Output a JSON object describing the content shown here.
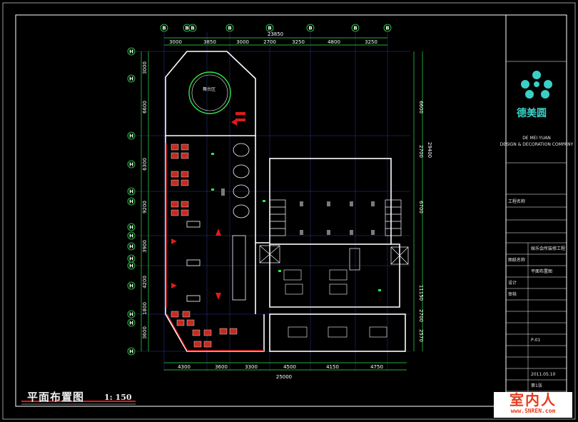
{
  "drawing": {
    "title": "平面布置图",
    "scale": "1: 150"
  },
  "dimensions": {
    "top_total": "23850",
    "top_segments": [
      "3000",
      "3850",
      "3000",
      "2700",
      "3250",
      "4800",
      "3250"
    ],
    "bottom_total": "25000",
    "bottom_segments": [
      "4300",
      "3600",
      "3300",
      "4500",
      "4150",
      "4750"
    ],
    "left_segments": [
      "3000",
      "6600",
      "6300",
      "9200",
      "3900",
      "4200",
      "1800",
      "3600"
    ],
    "right_total": "29400",
    "right_segments": [
      "6600",
      "2700",
      "6700",
      "11150",
      "2700",
      "2570"
    ]
  },
  "axis_labels": {
    "top": [
      "B",
      "B",
      "B",
      "B",
      "B",
      "B",
      "B",
      "B"
    ],
    "left": [
      "H",
      "H",
      "H",
      "H",
      "H",
      "H",
      "H",
      "H",
      "H",
      "H",
      "H",
      "H",
      "H",
      "H",
      "H"
    ]
  },
  "room_labels": {
    "stage": "舞台区"
  },
  "title_block": {
    "company_name": "德美圆",
    "company_en_1": "DE MEI YUAN",
    "company_en_2": "DESIGN & DECORATION COMPANY",
    "project_label": "工程名称",
    "project_value": "娱乐会所装修工程",
    "drawing_label": "图纸名称",
    "drawing_value": "平面布置图",
    "design_label": "设计",
    "check_label": "审核",
    "date_value": "2011.05.10",
    "sheet_value": "第1张",
    "number_label": "P-01"
  },
  "watermark": {
    "main": "室内人",
    "url": "www.SNREN.com"
  }
}
